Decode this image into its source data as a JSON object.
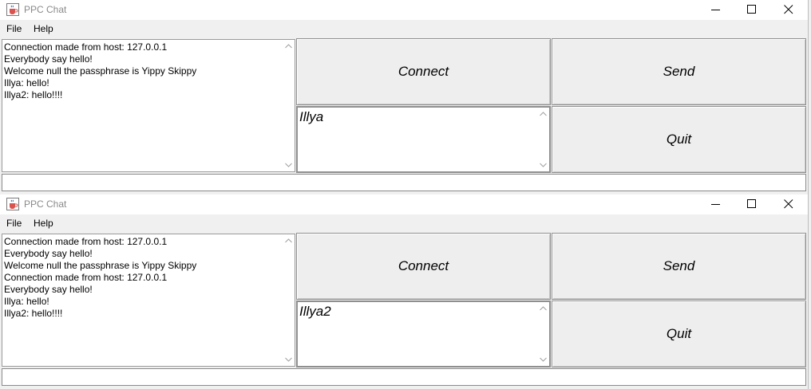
{
  "windows": [
    {
      "title": "PPC Chat",
      "menu": [
        "File",
        "Help"
      ],
      "log": "Connection made from host: 127.0.0.1\nEverybody say hello!\nWelcome null the passphrase is Yippy Skippy\nIllya: hello!\nIllya2: hello!!!!",
      "username": "Illya",
      "buttons": {
        "connect": "Connect",
        "send": "Send",
        "quit": "Quit"
      },
      "message": ""
    },
    {
      "title": "PPC Chat",
      "menu": [
        "File",
        "Help"
      ],
      "log": "Connection made from host: 127.0.0.1\nEverybody say hello!\nWelcome null the passphrase is Yippy Skippy\nConnection made from host: 127.0.0.1\nEverybody say hello!\nIllya: hello!\nIllya2: hello!!!!",
      "username": "Illya2",
      "buttons": {
        "connect": "Connect",
        "send": "Send",
        "quit": "Quit"
      },
      "message": ""
    }
  ],
  "icons": {
    "app": "java-coffee-cup-icon",
    "minimize": "minimize-icon",
    "maximize": "maximize-icon",
    "close": "close-icon",
    "scroll_up": "scroll-up-arrow-icon",
    "scroll_down": "scroll-down-arrow-icon"
  }
}
